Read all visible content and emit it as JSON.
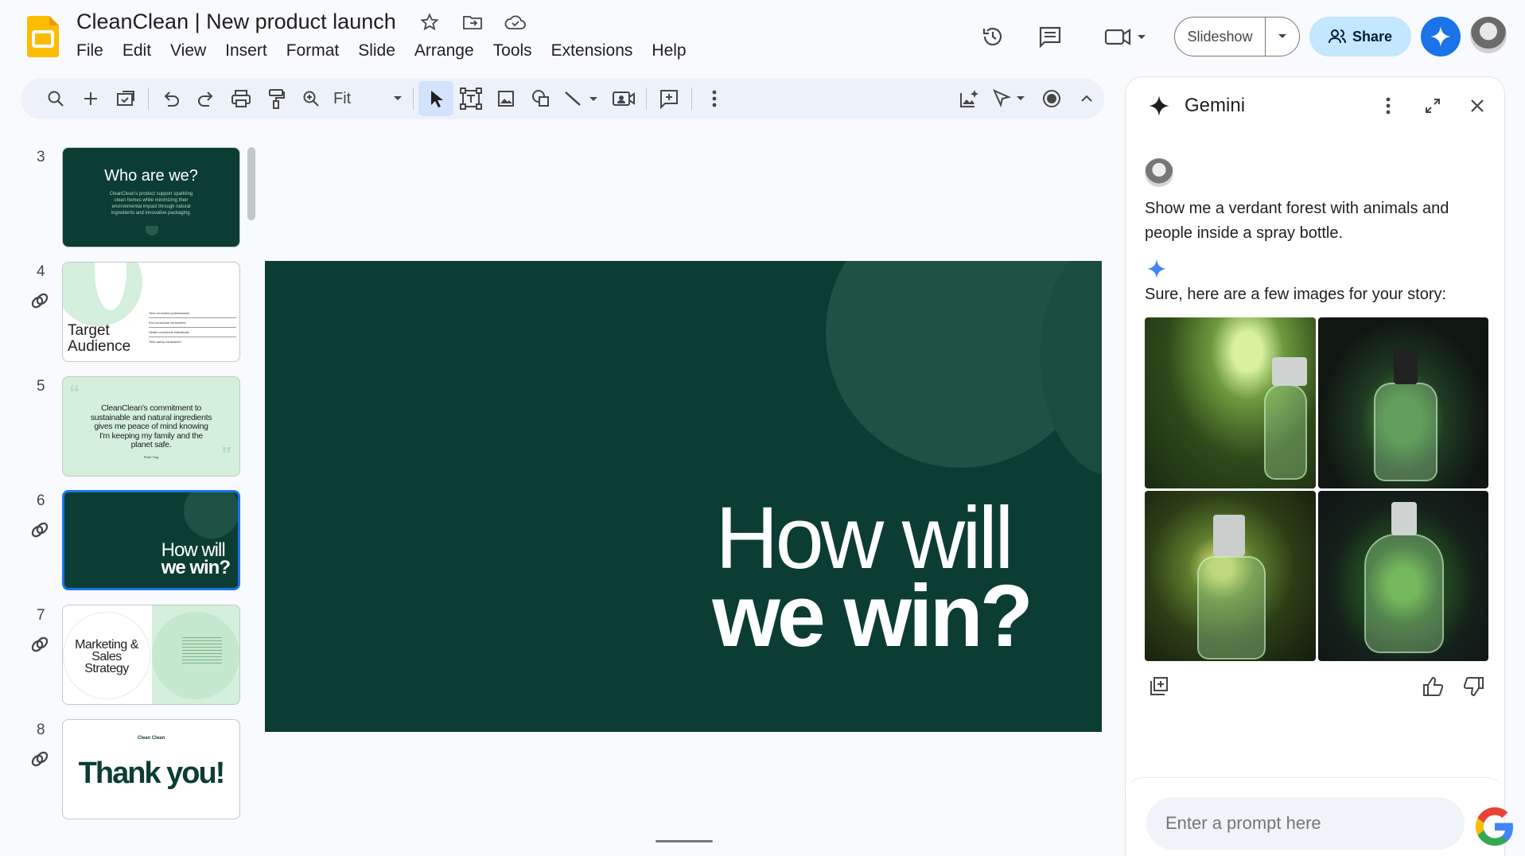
{
  "app": {
    "title": "CleanClean | New product launch",
    "menu": [
      "File",
      "Edit",
      "View",
      "Insert",
      "Format",
      "Slide",
      "Arrange",
      "Tools",
      "Extensions",
      "Help"
    ]
  },
  "header": {
    "slideshow_label": "Slideshow",
    "share_label": "Share"
  },
  "toolbar": {
    "zoom_value": "Fit"
  },
  "filmstrip": {
    "slides": [
      {
        "number": "3",
        "title": "Who are we?",
        "body": "CleanClean's product support sparkling clean homes while minimizing their environmental impact through natural ingredients and innovative packaging."
      },
      {
        "number": "4",
        "title": "Target Audience",
        "rows": [
          "Time-crunched professionals",
          "Eco-conscious consumers",
          "Health-conscious individuals",
          "Tech-savvy consumers"
        ]
      },
      {
        "number": "5",
        "quote": "CleanClean's commitment to sustainable and natural ingredients gives me peace of mind knowing I'm keeping my family and the planet safe.",
        "author": "Peter Ying"
      },
      {
        "number": "6",
        "title_line1": "How will",
        "title_line2": "we win?"
      },
      {
        "number": "7",
        "title": "Marketing & Sales Strategy"
      },
      {
        "number": "8",
        "brand": "Clean Clean",
        "title": "Thank you!"
      }
    ]
  },
  "slide": {
    "title_line1": "How will",
    "title_line2": "we win?"
  },
  "gemini": {
    "title": "Gemini",
    "user_prompt": "Show me a verdant forest with animals and people inside a spray bottle.",
    "reply": "Sure, here are a few images for your story:",
    "input_placeholder": "Enter a prompt here"
  },
  "colors": {
    "slide_bg": "#0b3d33",
    "share_bg": "#c2e7ff",
    "gemini_blue": "#1a73e8"
  }
}
